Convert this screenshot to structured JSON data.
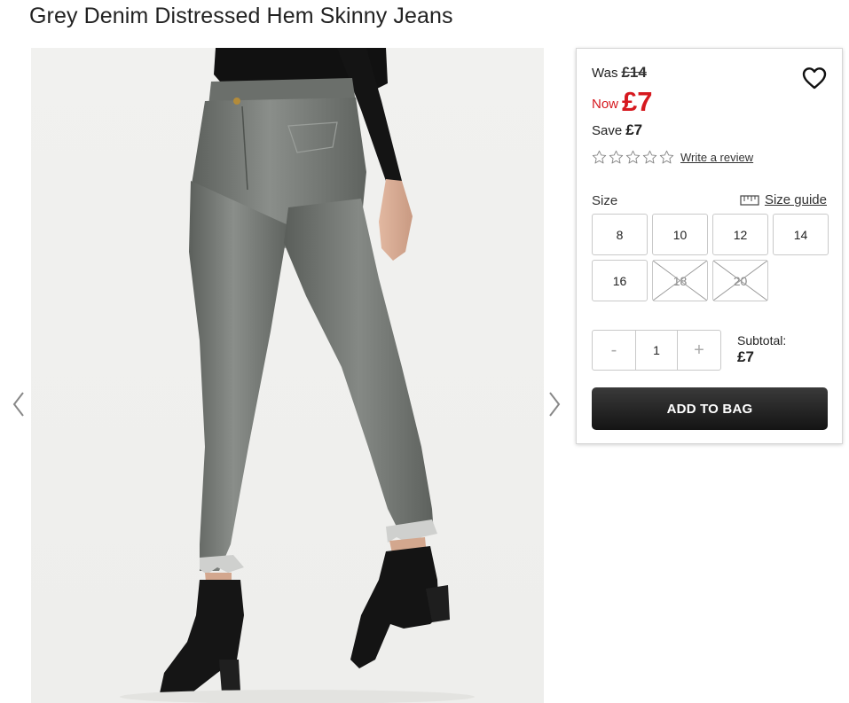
{
  "product": {
    "title": "Grey Denim Distressed Hem Skinny Jeans"
  },
  "gallery": {
    "image_alt": "model wearing grey skinny jeans and black ankle boots",
    "prev_icon": "chevron-left-icon",
    "next_icon": "chevron-right-icon"
  },
  "price": {
    "was_label": "Was",
    "was_value": "£14",
    "now_label": "Now",
    "now_value": "£7",
    "save_label": "Save",
    "save_value": "£7",
    "accent_color": "#d6191f"
  },
  "rating": {
    "stars_total": 5,
    "stars_filled": 0,
    "review_link": "Write a review"
  },
  "size": {
    "label": "Size",
    "guide_link": "Size guide",
    "options": [
      {
        "label": "8",
        "available": true
      },
      {
        "label": "10",
        "available": true
      },
      {
        "label": "12",
        "available": true
      },
      {
        "label": "14",
        "available": true
      },
      {
        "label": "16",
        "available": true
      },
      {
        "label": "18",
        "available": false
      },
      {
        "label": "20",
        "available": false
      }
    ]
  },
  "quantity": {
    "minus": "-",
    "value": "1",
    "plus": "+"
  },
  "subtotal": {
    "label": "Subtotal:",
    "value": "£7"
  },
  "actions": {
    "add_to_bag": "ADD TO BAG",
    "wishlist_icon": "heart-icon"
  }
}
